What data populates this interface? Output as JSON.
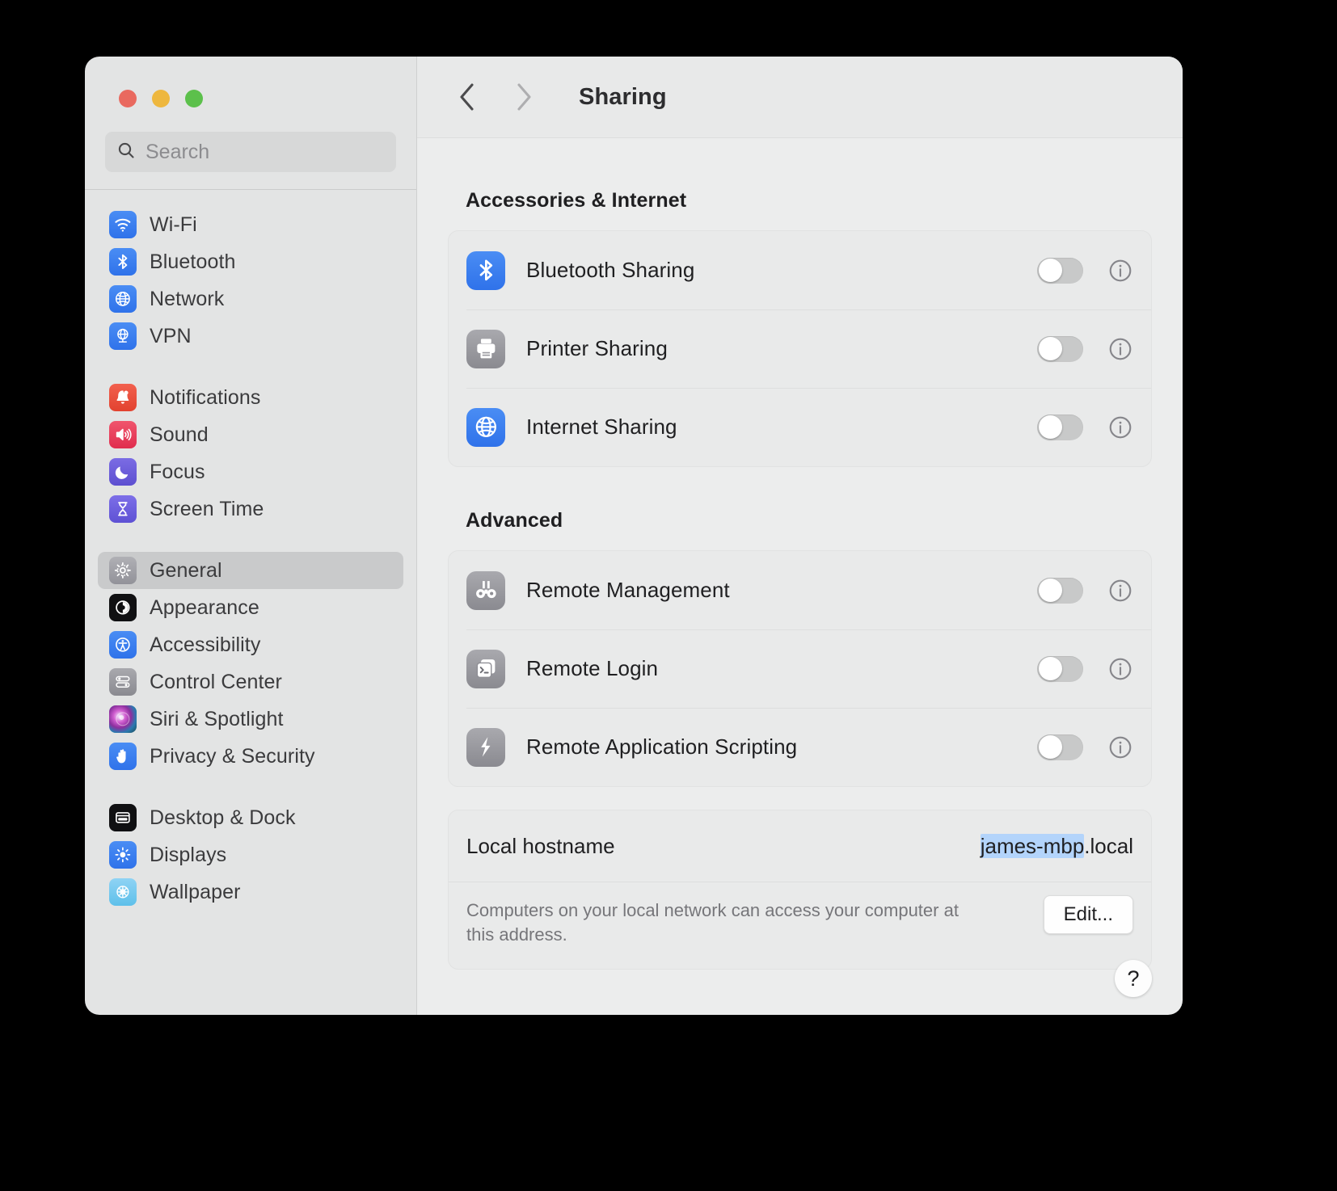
{
  "window": {
    "traffic_lights": [
      {
        "name": "close",
        "color": "#e9695f"
      },
      {
        "name": "minimize",
        "color": "#eeb73e"
      },
      {
        "name": "zoom",
        "color": "#5cc04b"
      }
    ]
  },
  "sidebar": {
    "search": {
      "placeholder": "Search",
      "value": ""
    },
    "groups": [
      {
        "items": [
          {
            "label": "Wi-Fi",
            "icon": "wifi-icon",
            "selected": false
          },
          {
            "label": "Bluetooth",
            "icon": "bluetooth-icon",
            "selected": false
          },
          {
            "label": "Network",
            "icon": "globe-icon",
            "selected": false
          },
          {
            "label": "VPN",
            "icon": "vpn-globe-icon",
            "selected": false
          }
        ]
      },
      {
        "items": [
          {
            "label": "Notifications",
            "icon": "bell-icon",
            "selected": false
          },
          {
            "label": "Sound",
            "icon": "speaker-icon",
            "selected": false
          },
          {
            "label": "Focus",
            "icon": "moon-icon",
            "selected": false
          },
          {
            "label": "Screen Time",
            "icon": "hourglass-icon",
            "selected": false
          }
        ]
      },
      {
        "items": [
          {
            "label": "General",
            "icon": "gear-icon",
            "selected": true
          },
          {
            "label": "Appearance",
            "icon": "appearance-icon",
            "selected": false
          },
          {
            "label": "Accessibility",
            "icon": "accessibility-icon",
            "selected": false
          },
          {
            "label": "Control Center",
            "icon": "sliders-icon",
            "selected": false
          },
          {
            "label": "Siri & Spotlight",
            "icon": "siri-icon",
            "selected": false
          },
          {
            "label": "Privacy & Security",
            "icon": "hand-icon",
            "selected": false
          }
        ]
      },
      {
        "items": [
          {
            "label": "Desktop & Dock",
            "icon": "desktop-dock-icon",
            "selected": false
          },
          {
            "label": "Displays",
            "icon": "brightness-icon",
            "selected": false
          },
          {
            "label": "Wallpaper",
            "icon": "wallpaper-icon",
            "selected": false
          }
        ]
      }
    ]
  },
  "toolbar": {
    "back_label": "Back",
    "forward_label": "Forward",
    "title": "Sharing"
  },
  "main": {
    "sections": [
      {
        "title": "Accessories & Internet",
        "rows": [
          {
            "label": "Bluetooth Sharing",
            "icon": "bluetooth-icon",
            "enabled": false,
            "info_label": "More info"
          },
          {
            "label": "Printer Sharing",
            "icon": "printer-icon",
            "enabled": false,
            "info_label": "More info"
          },
          {
            "label": "Internet Sharing",
            "icon": "globe-icon",
            "enabled": false,
            "info_label": "More info"
          }
        ]
      },
      {
        "title": "Advanced",
        "rows": [
          {
            "label": "Remote Management",
            "icon": "binoculars-icon",
            "enabled": false,
            "info_label": "More info"
          },
          {
            "label": "Remote Login",
            "icon": "terminal-icon",
            "enabled": false,
            "info_label": "More info"
          },
          {
            "label": "Remote Application Scripting",
            "icon": "script-icon",
            "enabled": false,
            "info_label": "More info"
          }
        ]
      }
    ],
    "hostname": {
      "label": "Local hostname",
      "value_selected": "james-mbp",
      "value_rest": ".local",
      "description": "Computers on your local network can access your computer at this address.",
      "edit_button": "Edit..."
    },
    "help_button": "?"
  },
  "colors": {
    "accent_blue": "#3b7ff0",
    "selection_blue": "#b3d4fb",
    "sidebar_bg": "#e3e4e4",
    "main_bg": "#eceded",
    "card_bg": "#e9eaea"
  }
}
